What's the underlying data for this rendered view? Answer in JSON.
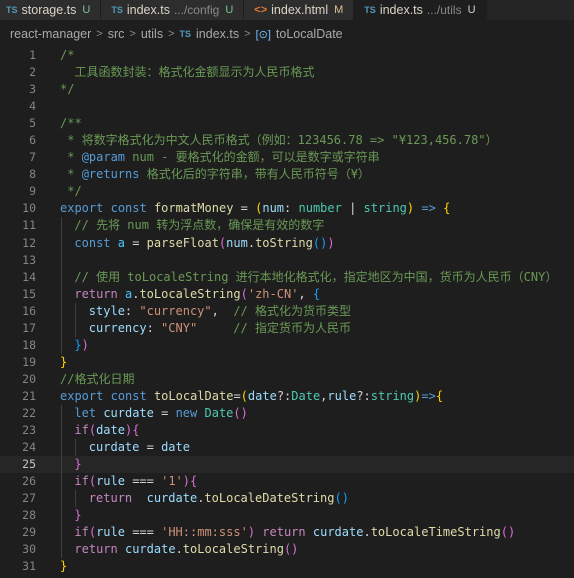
{
  "tabs": [
    {
      "icon": "TS",
      "name": "storage.ts",
      "path": "",
      "status": "U",
      "active": false
    },
    {
      "icon": "TS",
      "name": "index.ts",
      "path": ".../config",
      "status": "U",
      "active": false
    },
    {
      "icon": "<>",
      "name": "index.html",
      "path": "",
      "status": "M",
      "active": false
    },
    {
      "icon": "TS",
      "name": "index.ts",
      "path": ".../utils",
      "status": "U",
      "active": true
    }
  ],
  "breadcrumb": {
    "parts": [
      "react-manager",
      "src",
      "utils"
    ],
    "file_icon": "TS",
    "file": "index.ts",
    "symbol_icon": "[⊙]",
    "symbol": "toLocalDate"
  },
  "current_line": 25,
  "lines": [
    {
      "n": 1,
      "indent": 1,
      "tokens": [
        [
          "cm",
          "/*"
        ]
      ]
    },
    {
      "n": 2,
      "indent": 1,
      "tokens": [
        [
          "cm",
          "  工具函数封装：格式化金额显示为人民币格式"
        ]
      ]
    },
    {
      "n": 3,
      "indent": 1,
      "tokens": [
        [
          "cm",
          "*/"
        ]
      ]
    },
    {
      "n": 4,
      "indent": 0,
      "tokens": []
    },
    {
      "n": 5,
      "indent": 1,
      "tokens": [
        [
          "cm",
          "/**"
        ]
      ]
    },
    {
      "n": 6,
      "indent": 1,
      "tokens": [
        [
          "cm",
          " * 将数字格式化为中文人民币格式（例如：123456.78 => \"¥123,456.78\"）"
        ]
      ]
    },
    {
      "n": 7,
      "indent": 1,
      "tokens": [
        [
          "cm",
          " * "
        ],
        [
          "doctag",
          "@param"
        ],
        [
          "cm",
          " num - 要格式化的金额，可以是数字或字符串"
        ]
      ]
    },
    {
      "n": 8,
      "indent": 1,
      "tokens": [
        [
          "cm",
          " * "
        ],
        [
          "doctag",
          "@returns"
        ],
        [
          "cm",
          " 格式化后的字符串，带有人民币符号（¥）"
        ]
      ]
    },
    {
      "n": 9,
      "indent": 1,
      "tokens": [
        [
          "cm",
          " */"
        ]
      ]
    },
    {
      "n": 10,
      "indent": 1,
      "tokens": [
        [
          "kw",
          "export"
        ],
        [
          "op",
          " "
        ],
        [
          "kw",
          "const"
        ],
        [
          "op",
          " "
        ],
        [
          "fn",
          "formatMoney"
        ],
        [
          "op",
          " = "
        ],
        [
          "br1",
          "("
        ],
        [
          "var",
          "num"
        ],
        [
          "op",
          ": "
        ],
        [
          "type",
          "number"
        ],
        [
          "op",
          " | "
        ],
        [
          "type",
          "string"
        ],
        [
          "br1",
          ")"
        ],
        [
          "op",
          " "
        ],
        [
          "kw",
          "=>"
        ],
        [
          "op",
          " "
        ],
        [
          "br1",
          "{"
        ]
      ]
    },
    {
      "n": 11,
      "indent": 2,
      "guides": [
        1
      ],
      "tokens": [
        [
          "cm",
          "// 先将 num 转为浮点数，确保是有效的数字"
        ]
      ]
    },
    {
      "n": 12,
      "indent": 2,
      "guides": [
        1
      ],
      "tokens": [
        [
          "kw",
          "const"
        ],
        [
          "op",
          " "
        ],
        [
          "const",
          "a"
        ],
        [
          "op",
          " = "
        ],
        [
          "fn",
          "parseFloat"
        ],
        [
          "br2",
          "("
        ],
        [
          "var",
          "num"
        ],
        [
          "op",
          "."
        ],
        [
          "fn",
          "toString"
        ],
        [
          "br3",
          "()"
        ],
        [
          "br2",
          ")"
        ]
      ]
    },
    {
      "n": 13,
      "indent": 0,
      "guides": [
        1
      ],
      "tokens": []
    },
    {
      "n": 14,
      "indent": 2,
      "guides": [
        1
      ],
      "tokens": [
        [
          "cm",
          "// 使用 toLocaleString 进行本地化格式化，指定地区为中国，货币为人民币（CNY）"
        ]
      ]
    },
    {
      "n": 15,
      "indent": 2,
      "guides": [
        1
      ],
      "tokens": [
        [
          "ctl",
          "return"
        ],
        [
          "op",
          " "
        ],
        [
          "const",
          "a"
        ],
        [
          "op",
          "."
        ],
        [
          "fn",
          "toLocaleString"
        ],
        [
          "br2",
          "("
        ],
        [
          "str",
          "'zh-CN'"
        ],
        [
          "op",
          ", "
        ],
        [
          "br3",
          "{"
        ]
      ]
    },
    {
      "n": 16,
      "indent": 3,
      "guides": [
        1,
        2
      ],
      "tokens": [
        [
          "var",
          "style"
        ],
        [
          "op",
          ": "
        ],
        [
          "str",
          "\"currency\""
        ],
        [
          "op",
          ",  "
        ],
        [
          "cm",
          "// 格式化为货币类型"
        ]
      ]
    },
    {
      "n": 17,
      "indent": 3,
      "guides": [
        1,
        2
      ],
      "tokens": [
        [
          "var",
          "currency"
        ],
        [
          "op",
          ": "
        ],
        [
          "str",
          "\"CNY\""
        ],
        [
          "op",
          "     "
        ],
        [
          "cm",
          "// 指定货币为人民币"
        ]
      ]
    },
    {
      "n": 18,
      "indent": 2,
      "guides": [
        1
      ],
      "tokens": [
        [
          "br3",
          "}"
        ],
        [
          "br2",
          ")"
        ]
      ]
    },
    {
      "n": 19,
      "indent": 1,
      "tokens": [
        [
          "br1",
          "}"
        ]
      ]
    },
    {
      "n": 20,
      "indent": 1,
      "tokens": [
        [
          "cm",
          "//格式化日期"
        ]
      ]
    },
    {
      "n": 21,
      "indent": 1,
      "tokens": [
        [
          "kw",
          "export"
        ],
        [
          "op",
          " "
        ],
        [
          "kw",
          "const"
        ],
        [
          "op",
          " "
        ],
        [
          "fn",
          "toLocalDate"
        ],
        [
          "op",
          "="
        ],
        [
          "br1",
          "("
        ],
        [
          "var",
          "date"
        ],
        [
          "op",
          "?:"
        ],
        [
          "type",
          "Date"
        ],
        [
          "op",
          ","
        ],
        [
          "var",
          "rule"
        ],
        [
          "op",
          "?:"
        ],
        [
          "type",
          "string"
        ],
        [
          "br1",
          ")"
        ],
        [
          "kw",
          "=>"
        ],
        [
          "br1",
          "{"
        ]
      ]
    },
    {
      "n": 22,
      "indent": 2,
      "guides": [
        1
      ],
      "tokens": [
        [
          "kw",
          "let"
        ],
        [
          "op",
          " "
        ],
        [
          "var",
          "curdate"
        ],
        [
          "op",
          " = "
        ],
        [
          "kw",
          "new"
        ],
        [
          "op",
          " "
        ],
        [
          "type",
          "Date"
        ],
        [
          "br2",
          "()"
        ]
      ]
    },
    {
      "n": 23,
      "indent": 2,
      "guides": [
        1
      ],
      "tokens": [
        [
          "ctl",
          "if"
        ],
        [
          "br2",
          "("
        ],
        [
          "var",
          "date"
        ],
        [
          "br2",
          ")"
        ],
        [
          "br2",
          "{"
        ]
      ]
    },
    {
      "n": 24,
      "indent": 3,
      "guides": [
        1,
        2
      ],
      "tokens": [
        [
          "var",
          "curdate"
        ],
        [
          "op",
          " = "
        ],
        [
          "var",
          "date"
        ]
      ]
    },
    {
      "n": 25,
      "indent": 2,
      "guides": [
        1
      ],
      "tokens": [
        [
          "br2",
          "}"
        ]
      ]
    },
    {
      "n": 26,
      "indent": 2,
      "guides": [
        1
      ],
      "tokens": [
        [
          "ctl",
          "if"
        ],
        [
          "br2",
          "("
        ],
        [
          "var",
          "rule"
        ],
        [
          "op",
          " === "
        ],
        [
          "str",
          "'1'"
        ],
        [
          "br2",
          ")"
        ],
        [
          "br2",
          "{"
        ]
      ]
    },
    {
      "n": 27,
      "indent": 3,
      "guides": [
        1,
        2
      ],
      "tokens": [
        [
          "ctl",
          "return"
        ],
        [
          "op",
          "  "
        ],
        [
          "var",
          "curdate"
        ],
        [
          "op",
          "."
        ],
        [
          "fn",
          "toLocaleDateString"
        ],
        [
          "br3",
          "()"
        ]
      ]
    },
    {
      "n": 28,
      "indent": 2,
      "guides": [
        1
      ],
      "tokens": [
        [
          "br2",
          "}"
        ]
      ]
    },
    {
      "n": 29,
      "indent": 2,
      "guides": [
        1
      ],
      "tokens": [
        [
          "ctl",
          "if"
        ],
        [
          "br2",
          "("
        ],
        [
          "var",
          "rule"
        ],
        [
          "op",
          " === "
        ],
        [
          "str",
          "'HH::mm:sss'"
        ],
        [
          "br2",
          ")"
        ],
        [
          "op",
          " "
        ],
        [
          "ctl",
          "return"
        ],
        [
          "op",
          " "
        ],
        [
          "var",
          "curdate"
        ],
        [
          "op",
          "."
        ],
        [
          "fn",
          "toLocaleTimeString"
        ],
        [
          "br2",
          "()"
        ]
      ]
    },
    {
      "n": 30,
      "indent": 2,
      "guides": [
        1
      ],
      "tokens": [
        [
          "ctl",
          "return"
        ],
        [
          "op",
          " "
        ],
        [
          "var",
          "curdate"
        ],
        [
          "op",
          "."
        ],
        [
          "fn",
          "toLocaleString"
        ],
        [
          "br2",
          "()"
        ]
      ]
    },
    {
      "n": 31,
      "indent": 1,
      "tokens": [
        [
          "br1",
          "}"
        ]
      ]
    }
  ]
}
